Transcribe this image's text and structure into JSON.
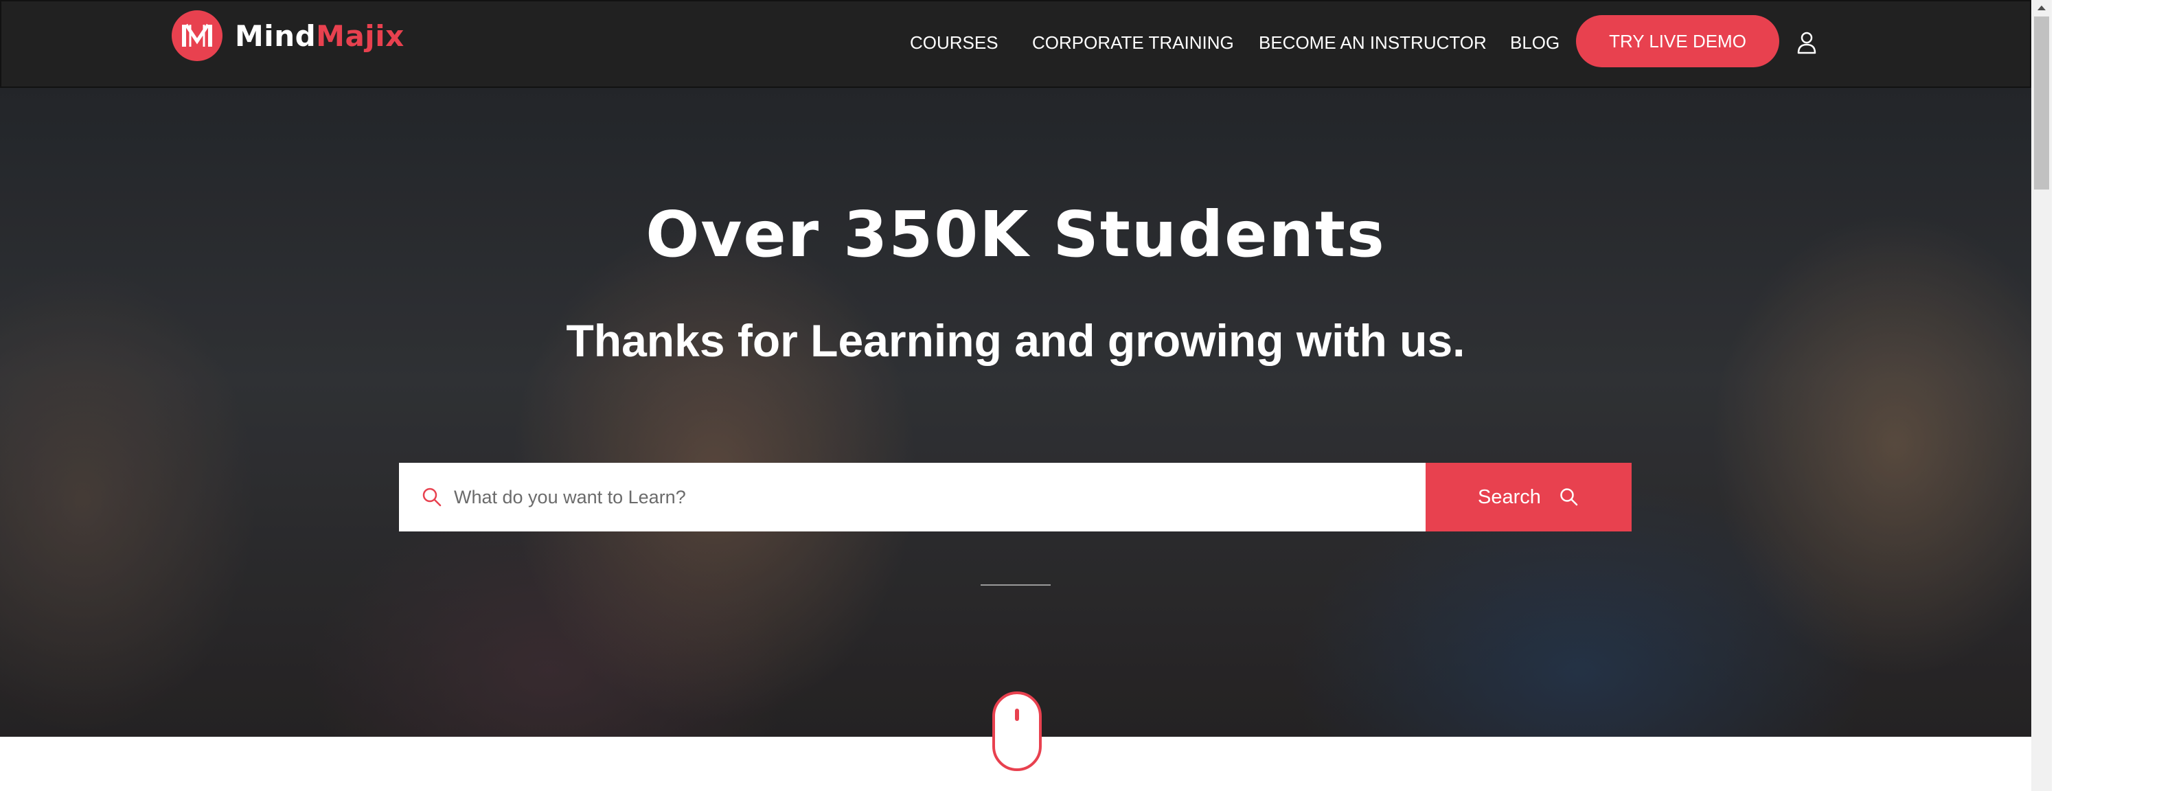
{
  "brand": {
    "name_part1": "Mind",
    "name_part2": "Majix",
    "accent_color": "#e8414f"
  },
  "nav": {
    "items": [
      {
        "label": "COURSES"
      },
      {
        "label": "CORPORATE TRAINING"
      },
      {
        "label": "BECOME AN INSTRUCTOR"
      },
      {
        "label": "BLOG"
      }
    ],
    "demo_label": "TRY LIVE DEMO",
    "user_icon": "user-icon"
  },
  "hero": {
    "title": "Over 350K Students",
    "subtitle": "Thanks for Learning and growing with us."
  },
  "search": {
    "placeholder": "What do you want to Learn?",
    "value": "",
    "button_label": "Search",
    "icon": "search-icon"
  },
  "scroll_indicator": {
    "icon": "mouse-scroll-icon"
  }
}
